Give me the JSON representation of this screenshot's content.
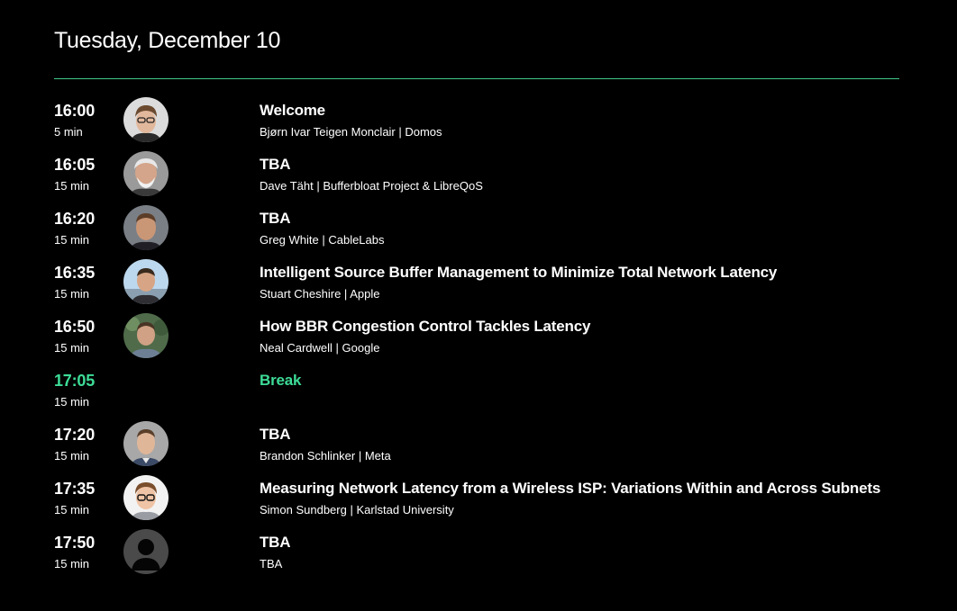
{
  "page": {
    "day_title": "Tuesday, December 10",
    "accent_color": "#3ddc97",
    "divider_color": "#3ec98a"
  },
  "schedule": [
    {
      "time": "16:00",
      "duration": "5 min",
      "title": "Welcome",
      "speaker": "Bjørn Ivar Teigen Monclair | Domos",
      "avatar": "speaker-photo",
      "is_break": false
    },
    {
      "time": "16:05",
      "duration": "15 min",
      "title": "TBA",
      "speaker": "Dave Täht | Bufferbloat Project & LibreQoS",
      "avatar": "speaker-photo",
      "is_break": false
    },
    {
      "time": "16:20",
      "duration": "15 min",
      "title": "TBA",
      "speaker": "Greg White | CableLabs",
      "avatar": "speaker-photo",
      "is_break": false
    },
    {
      "time": "16:35",
      "duration": "15 min",
      "title": "Intelligent Source Buffer Management to Minimize Total Network Latency",
      "speaker": "Stuart Cheshire | Apple",
      "avatar": "speaker-photo",
      "is_break": false
    },
    {
      "time": "16:50",
      "duration": "15 min",
      "title": "How BBR Congestion Control Tackles Latency",
      "speaker": "Neal Cardwell | Google",
      "avatar": "speaker-photo",
      "is_break": false
    },
    {
      "time": "17:05",
      "duration": "15 min",
      "title": "Break",
      "speaker": "",
      "avatar": "",
      "is_break": true
    },
    {
      "time": "17:20",
      "duration": "15 min",
      "title": "TBA",
      "speaker": "Brandon Schlinker | Meta",
      "avatar": "speaker-photo",
      "is_break": false
    },
    {
      "time": "17:35",
      "duration": "15 min",
      "title": "Measuring Network Latency from a Wireless ISP: Variations Within and Across Subnets",
      "speaker": "Simon Sundberg | Karlstad University",
      "avatar": "speaker-photo",
      "is_break": false
    },
    {
      "time": "17:50",
      "duration": "15 min",
      "title": "TBA",
      "speaker": "TBA",
      "avatar": "placeholder-avatar-icon",
      "is_break": false
    }
  ]
}
